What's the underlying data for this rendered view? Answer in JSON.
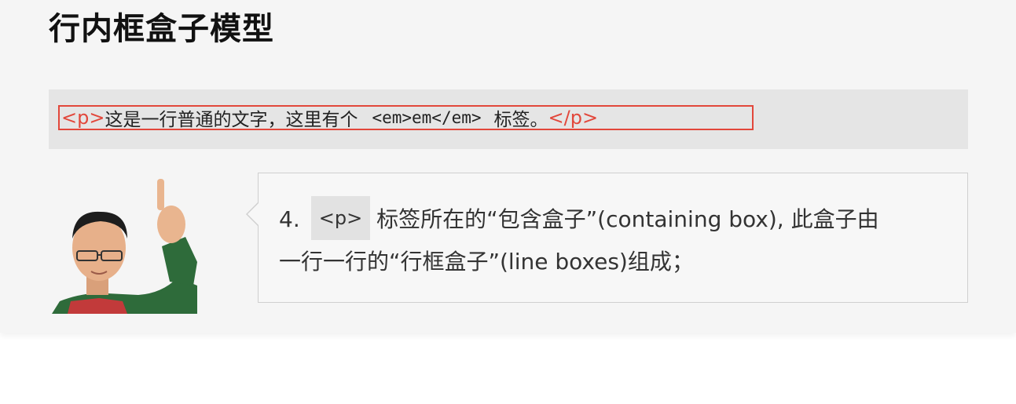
{
  "slide": {
    "title": "行内框盒子模型",
    "code_line": {
      "open_tag": "<p>",
      "text": "这是一行普通的文字，这里有个",
      "em_code": "<em>em</em>",
      "text_after": "标签。",
      "close_tag": "</p>"
    },
    "colors": {
      "highlight_red": "#e2473b",
      "band_gray": "#e5e5e5",
      "background": "#f5f5f5"
    },
    "note": {
      "number": "4.",
      "code": "<p>",
      "line1": "标签所在的“包含盒子”(containing box), 此盒子由",
      "line2": "一行一行的“行框盒子”(line boxes)组成；"
    },
    "presenter_icon": "person-pointing-up-icon"
  }
}
